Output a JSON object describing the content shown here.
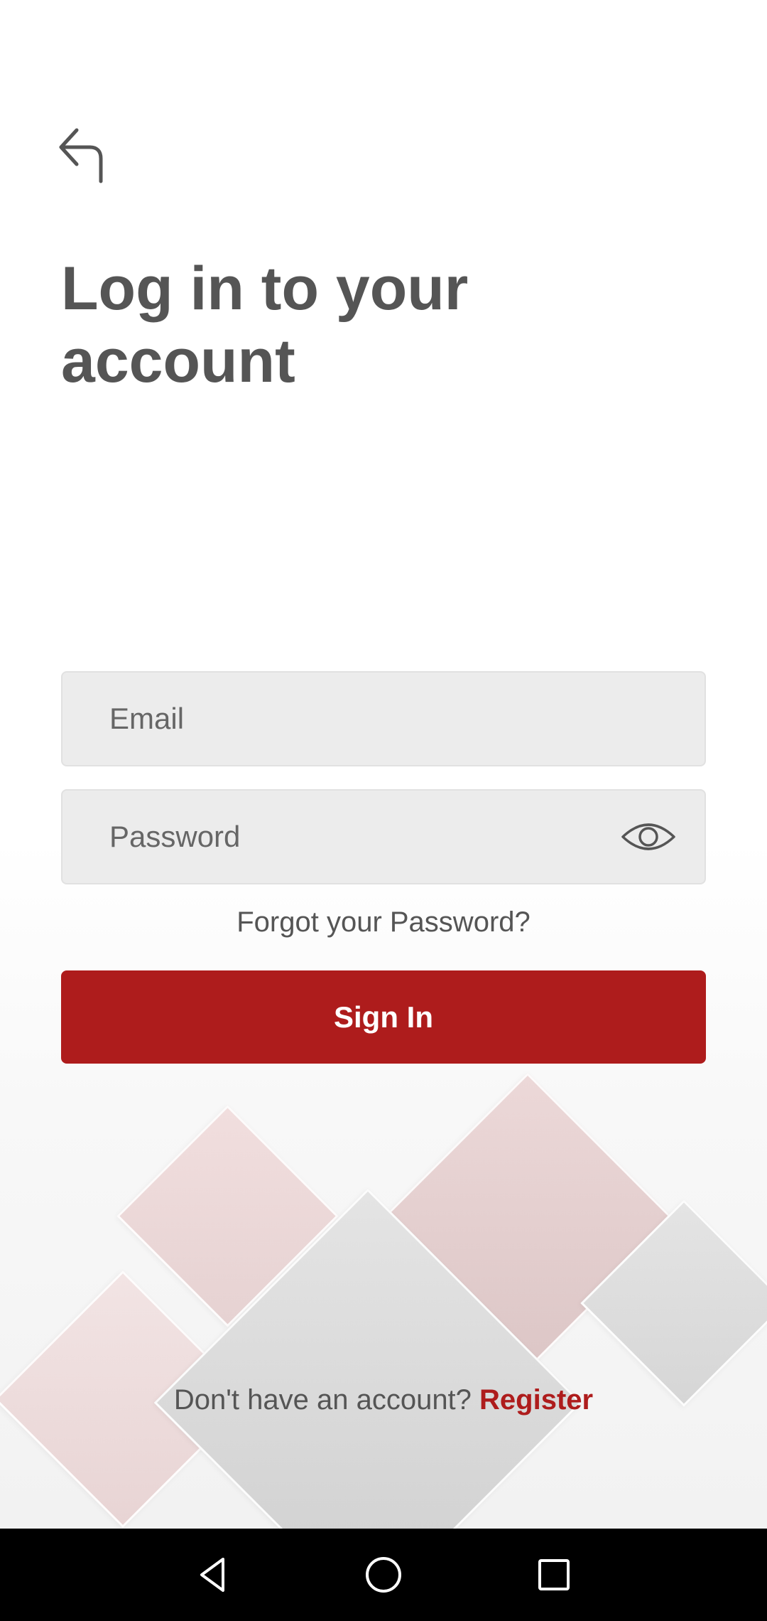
{
  "header": {
    "back_icon": "back-arrow-icon",
    "title_line1": "Log in to your",
    "title_line2": "account"
  },
  "form": {
    "email_placeholder": "Email",
    "email_value": "",
    "password_placeholder": "Password",
    "password_value": "",
    "password_visibility_icon": "eye-icon",
    "forgot_label": "Forgot your Password?",
    "signin_label": "Sign In"
  },
  "footer": {
    "prompt": "Don't have an account?",
    "register_label": "Register"
  },
  "navigation_bar": {
    "back_icon": "nav-back-icon",
    "home_icon": "nav-home-icon",
    "recents_icon": "nav-recents-icon"
  },
  "colors": {
    "accent": "#ae1c1c",
    "text": "#555555",
    "field_bg": "#ececec",
    "nav_bg": "#000000"
  }
}
